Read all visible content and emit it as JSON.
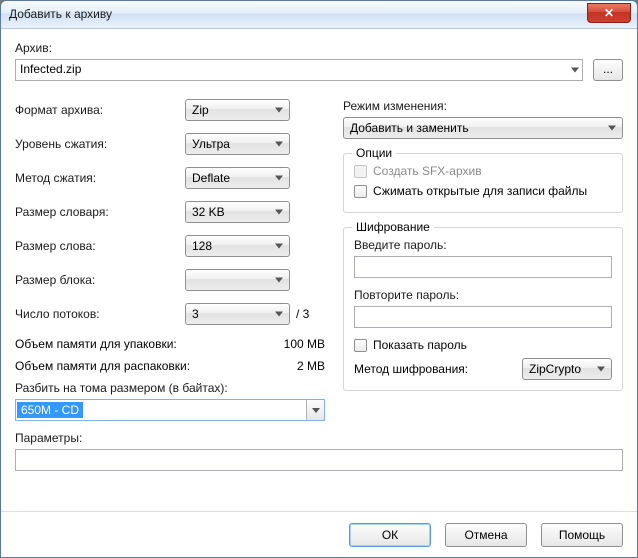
{
  "window": {
    "title": "Добавить к архиву"
  },
  "archive": {
    "label": "Архив:",
    "value": "Infected.zip",
    "browse": "..."
  },
  "left": {
    "format_label": "Формат архива:",
    "format_value": "Zip",
    "level_label": "Уровень сжатия:",
    "level_value": "Ультра",
    "method_label": "Метод сжатия:",
    "method_value": "Deflate",
    "dict_label": "Размер словаря:",
    "dict_value": "32 KB",
    "word_label": "Размер слова:",
    "word_value": "128",
    "block_label": "Размер блока:",
    "block_value": "",
    "threads_label": "Число потоков:",
    "threads_value": "3",
    "threads_max": "/ 3",
    "mem_pack_label": "Объем памяти для упаковки:",
    "mem_pack_value": "100 MB",
    "mem_unpack_label": "Объем памяти для распаковки:",
    "mem_unpack_value": "2 MB",
    "volumes_label": "Разбить на тома размером (в байтах):",
    "volumes_value": "650M - CD"
  },
  "right": {
    "mode_label": "Режим изменения:",
    "mode_value": "Добавить и заменить",
    "options_legend": "Опции",
    "opt_sfx": "Создать SFX-архив",
    "opt_compress_open": "Сжимать открытые для записи файлы",
    "encrypt_legend": "Шифрование",
    "pwd_label": "Введите пароль:",
    "pwd2_label": "Повторите пароль:",
    "show_pwd": "Показать пароль",
    "enc_method_label": "Метод шифрования:",
    "enc_method_value": "ZipCrypto"
  },
  "params": {
    "label": "Параметры:",
    "value": ""
  },
  "buttons": {
    "ok": "ОК",
    "cancel": "Отмена",
    "help": "Помощь"
  }
}
